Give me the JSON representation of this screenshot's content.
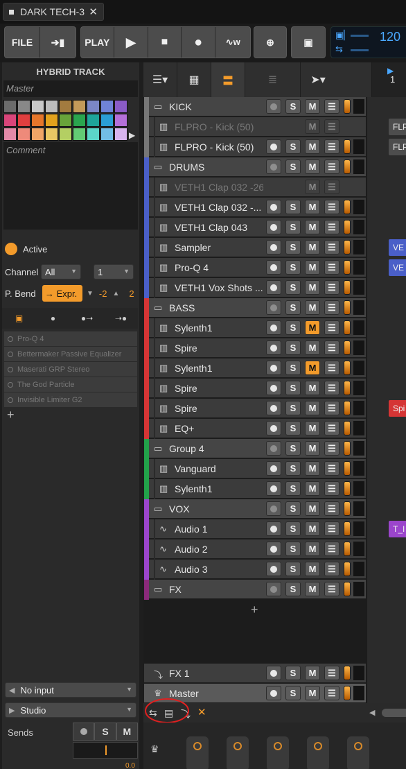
{
  "app": {
    "tab_title": "DARK TECH-3"
  },
  "toolbar": {
    "file": "FILE",
    "play_label": "PLAY",
    "tempo": "120",
    "tempo2": "4"
  },
  "inspector": {
    "title": "HYBRID TRACK",
    "name_placeholder": "Master",
    "comment_placeholder": "Comment",
    "active_label": "Active",
    "channel_label": "Channel",
    "channel_value": "All",
    "channel_num": "1",
    "pbend_label": "P. Bend",
    "pbend_mode": "→ Expr.",
    "pbend_down": "-2",
    "pbend_up": "2",
    "devices": [
      "Pro-Q 4",
      "Bettermaker Passive Equalizer",
      "Maserati GRP Stereo",
      "The God Particle",
      "Invisible Limiter G2"
    ],
    "input": "No input",
    "output": "Studio",
    "sends": "Sends",
    "sends_value": "0.0"
  },
  "palette": [
    "#6b6b6b",
    "#888888",
    "#c8c8c8",
    "#bdbdbd",
    "#a27b3f",
    "#c39a59",
    "#7b87c6",
    "#6f83d8",
    "#8a5bc6",
    "#d9457a",
    "#e03f3f",
    "#e4762b",
    "#e2a21d",
    "#68a33a",
    "#2aa54e",
    "#1ea59a",
    "#2a9ed6",
    "#b46fd9",
    "#e48aa8",
    "#ee8a7a",
    "#f0a567",
    "#e9c764",
    "#b4cf63",
    "#63cb74",
    "#5cd6c8",
    "#72bde6",
    "#d8b4ee"
  ],
  "tracks": [
    {
      "name": "KICK",
      "kind": "group",
      "color": "#777777",
      "m_on": false,
      "muted_row": false
    },
    {
      "name": "FLPRO - Kick (50)",
      "kind": "inst",
      "color": "#777777",
      "dim": true
    },
    {
      "name": "FLPRO - Kick (50)",
      "kind": "inst",
      "color": "#777777"
    },
    {
      "name": "DRUMS",
      "kind": "group",
      "color": "#4a5fc8"
    },
    {
      "name": "VETH1 Clap 032 -26ms",
      "kind": "inst",
      "color": "#4a5fc8",
      "dim": true
    },
    {
      "name": "VETH1 Clap 032 -...",
      "kind": "inst",
      "color": "#4a5fc8"
    },
    {
      "name": "VETH1 Clap 043",
      "kind": "inst",
      "color": "#4a5fc8"
    },
    {
      "name": "Sampler",
      "kind": "sampler",
      "color": "#4a5fc8"
    },
    {
      "name": "Pro-Q 4",
      "kind": "sampler",
      "color": "#4a5fc8"
    },
    {
      "name": "VETH1 Vox Shots ...",
      "kind": "inst",
      "color": "#4a5fc8"
    },
    {
      "name": "BASS",
      "kind": "group",
      "color": "#d53535"
    },
    {
      "name": "Sylenth1",
      "kind": "inst",
      "color": "#d53535",
      "m_on": true
    },
    {
      "name": "Spire",
      "kind": "inst",
      "color": "#d53535"
    },
    {
      "name": "Sylenth1",
      "kind": "inst",
      "color": "#d53535",
      "m_on": true
    },
    {
      "name": "Spire",
      "kind": "inst",
      "color": "#d53535"
    },
    {
      "name": "Spire",
      "kind": "inst",
      "color": "#d53535"
    },
    {
      "name": "EQ+",
      "kind": "inst",
      "color": "#d53535"
    },
    {
      "name": "Group 4",
      "kind": "group",
      "color": "#22a24a"
    },
    {
      "name": "Vanguard",
      "kind": "inst",
      "color": "#22a24a"
    },
    {
      "name": "Sylenth1",
      "kind": "inst",
      "color": "#22a24a"
    },
    {
      "name": "VOX",
      "kind": "group",
      "color": "#9b45cc"
    },
    {
      "name": "Audio 1",
      "kind": "audio",
      "color": "#9b45cc"
    },
    {
      "name": "Audio 2",
      "kind": "audio",
      "color": "#9b45cc"
    },
    {
      "name": "Audio 3",
      "kind": "audio",
      "color": "#9b45cc"
    },
    {
      "name": "FX",
      "kind": "group",
      "color": "#8a2a7a"
    }
  ],
  "bottom_tracks": [
    {
      "name": "FX 1",
      "kind": "fx"
    },
    {
      "name": "Master",
      "kind": "master"
    }
  ],
  "buttons": {
    "s": "S",
    "m": "M"
  },
  "ruler": {
    "bar": "1"
  },
  "clips": [
    {
      "text": "FLP",
      "row": 1,
      "color": "#4d4d4d"
    },
    {
      "text": "FLP",
      "row": 2,
      "color": "#4d4d4d"
    },
    {
      "text": "VE",
      "row": 7,
      "color": "#4a5fc8"
    },
    {
      "text": "VE",
      "row": 8,
      "color": "#4a5fc8"
    },
    {
      "text": "Spi",
      "row": 15,
      "color": "#d53535"
    },
    {
      "text": "T_I",
      "row": 21,
      "color": "#9b45cc"
    }
  ],
  "icons": {
    "folder": "folder-icon",
    "piano": "piano-icon",
    "audio": "waveform-icon"
  }
}
